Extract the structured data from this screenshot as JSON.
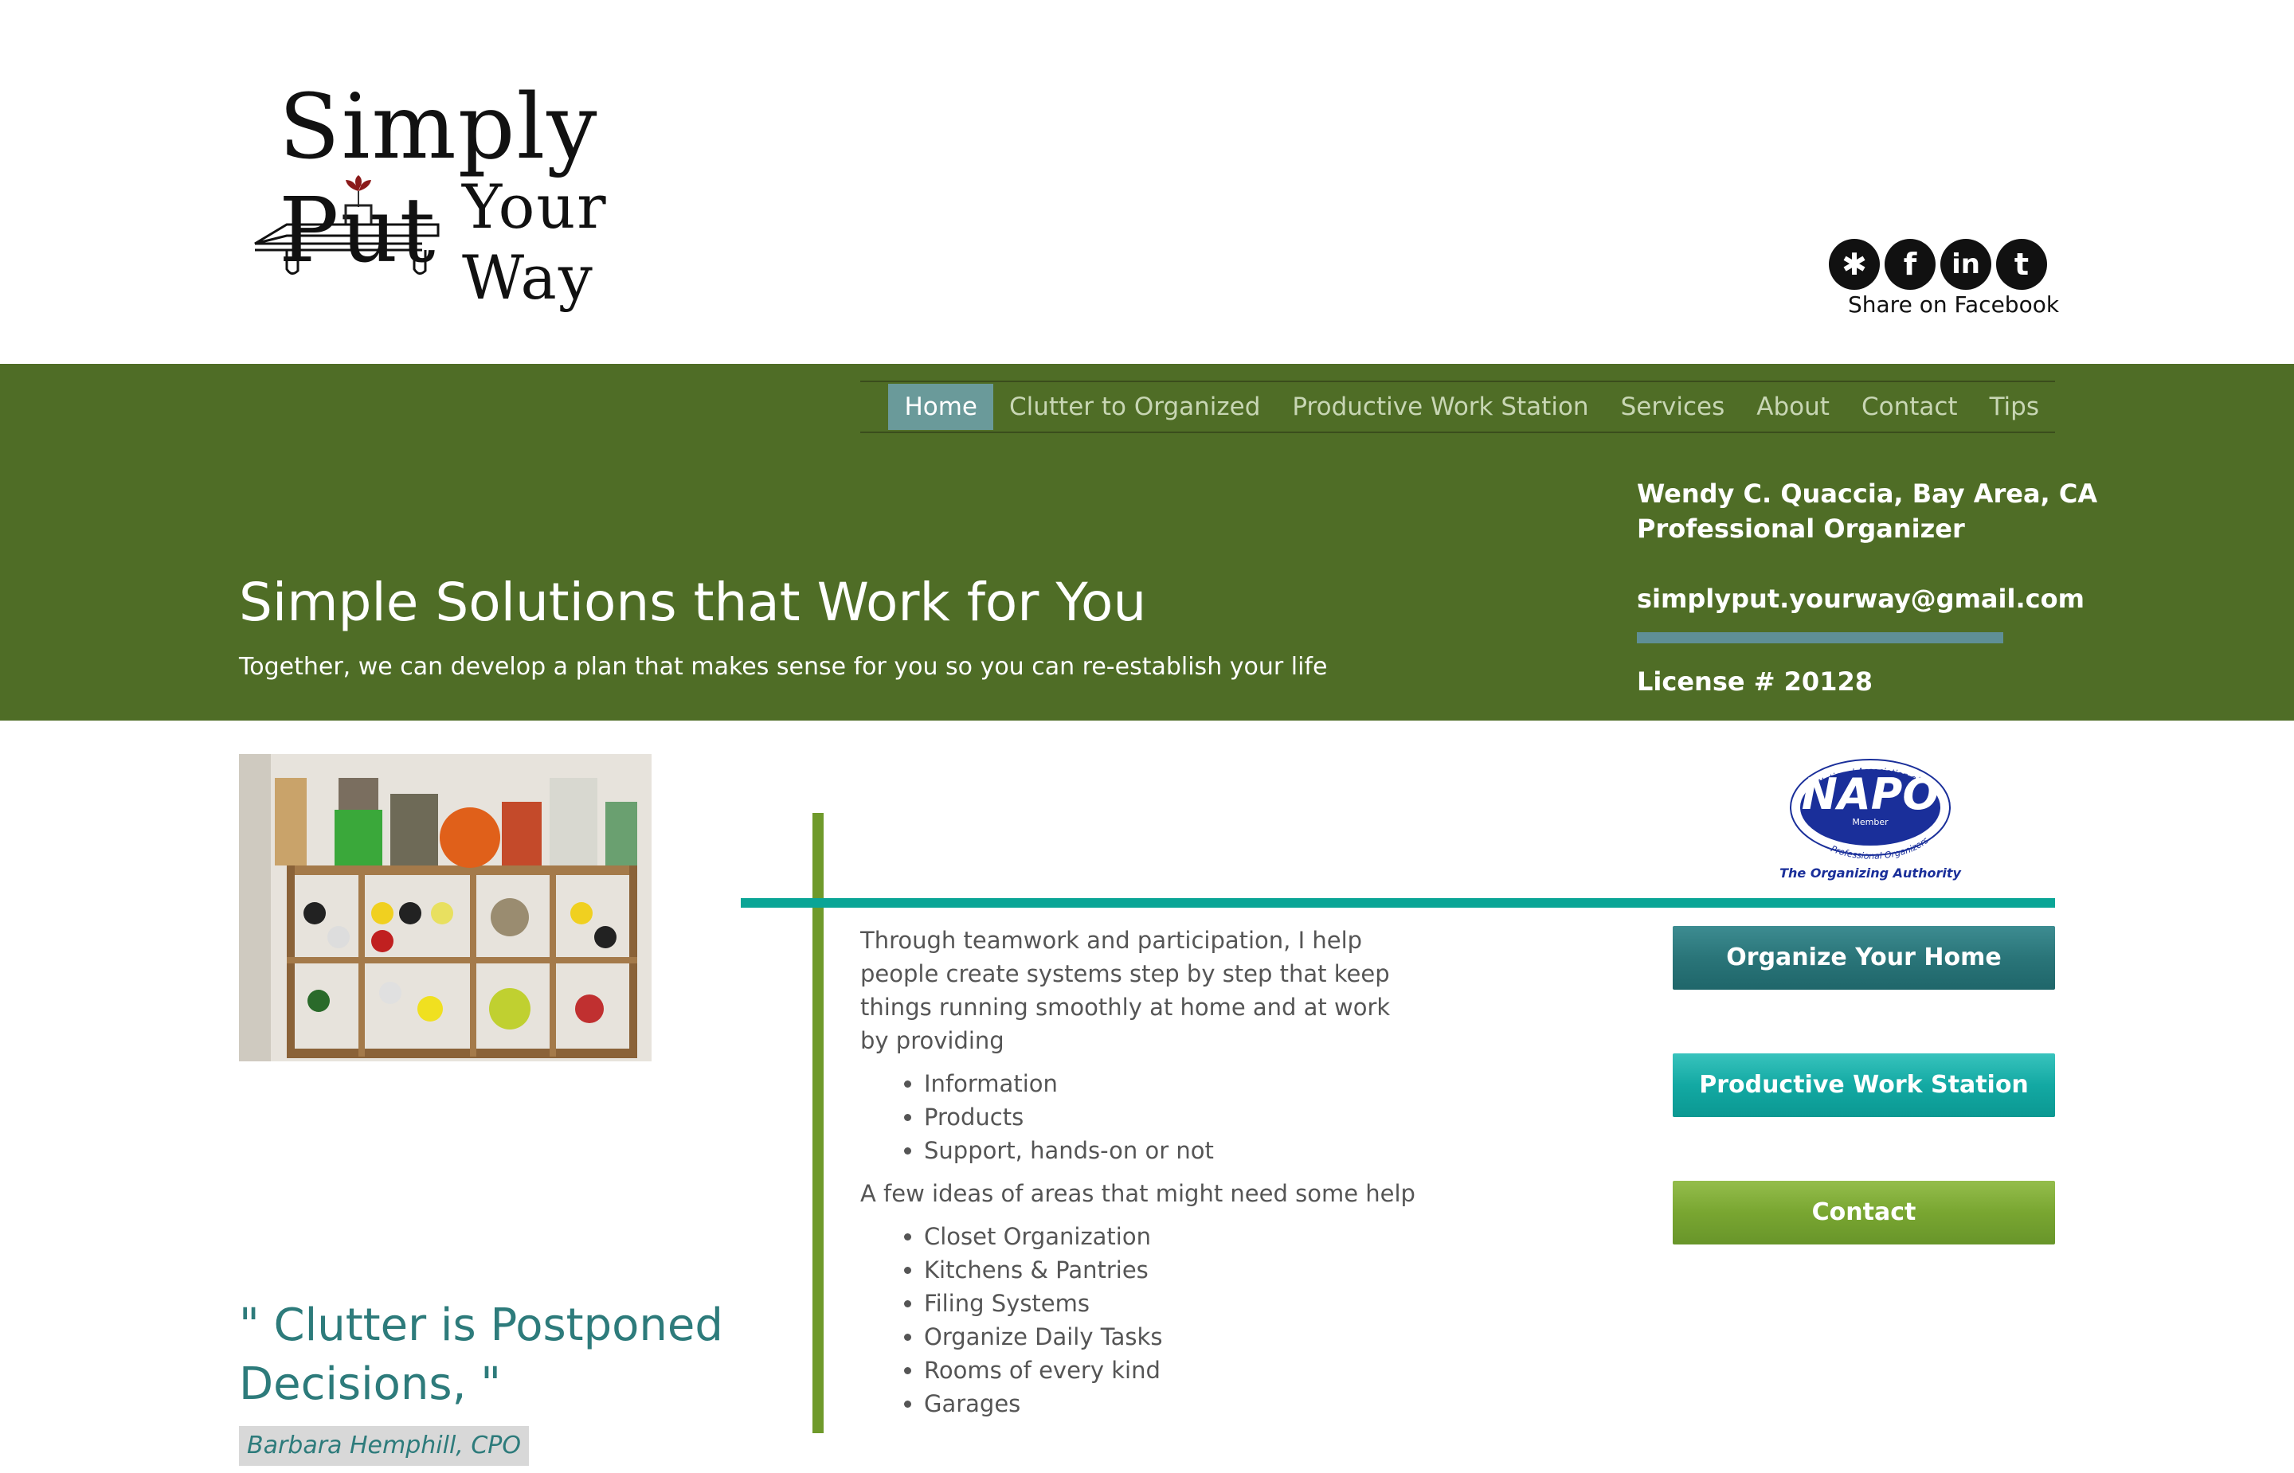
{
  "logo": {
    "line1": "Simply Put",
    "line2": "Your Way"
  },
  "social": {
    "icons": [
      "yelp-icon",
      "facebook-icon",
      "linkedin-icon",
      "twitter-icon"
    ],
    "icon_glyphs": {
      "yelp": "✱",
      "facebook": "f",
      "linkedin": "in",
      "twitter": "t"
    },
    "share_label": "Share on Facebook"
  },
  "nav": {
    "items": [
      {
        "label": "Home",
        "active": true
      },
      {
        "label": "Clutter to Organized",
        "active": false
      },
      {
        "label": "Productive Work Station",
        "active": false
      },
      {
        "label": "Services",
        "active": false
      },
      {
        "label": "About",
        "active": false
      },
      {
        "label": "Contact",
        "active": false
      },
      {
        "label": "Tips",
        "active": false
      }
    ]
  },
  "hero": {
    "title": "Simple Solutions that Work for You",
    "subtitle": "Together, we can develop a plan that makes sense for you so you can re-establish your life"
  },
  "contact": {
    "name_line": "Wendy C. Quaccia, Bay Area, CA",
    "role_line": "Professional Organizer",
    "email": "simplyput.yourway@gmail.com",
    "license": "License # 20128"
  },
  "quote": {
    "text": "\" Clutter is Postponed Decisions, \"",
    "author": "Barbara Hemphill, CPO"
  },
  "napo": {
    "arc_top": "National Association of",
    "name": "NAPO",
    "member": "Member",
    "arc_bottom": "Professional Organizers",
    "tagline": "The Organizing Authority"
  },
  "main": {
    "intro": "Through teamwork and participation, I help people create systems step by step that keep things running smoothly at home and at work by providing",
    "list1": [
      "Information",
      "Products",
      "Support, hands-on or not"
    ],
    "intro2": "A few ideas of areas that might need some help",
    "list2": [
      "Closet Organization",
      "Kitchens & Pantries",
      "Filing Systems",
      "Organize Daily Tasks",
      "Rooms of every kind",
      "Garages"
    ]
  },
  "buttons": {
    "organize_home": "Organize Your Home",
    "work_station": "Productive Work Station",
    "contact": "Contact"
  },
  "colors": {
    "band": "#4f6d26",
    "nav_active": "#6a9a9a",
    "teal_line": "#0aa596",
    "green_line": "#6f9a2b",
    "quote": "#2d7b7b"
  }
}
